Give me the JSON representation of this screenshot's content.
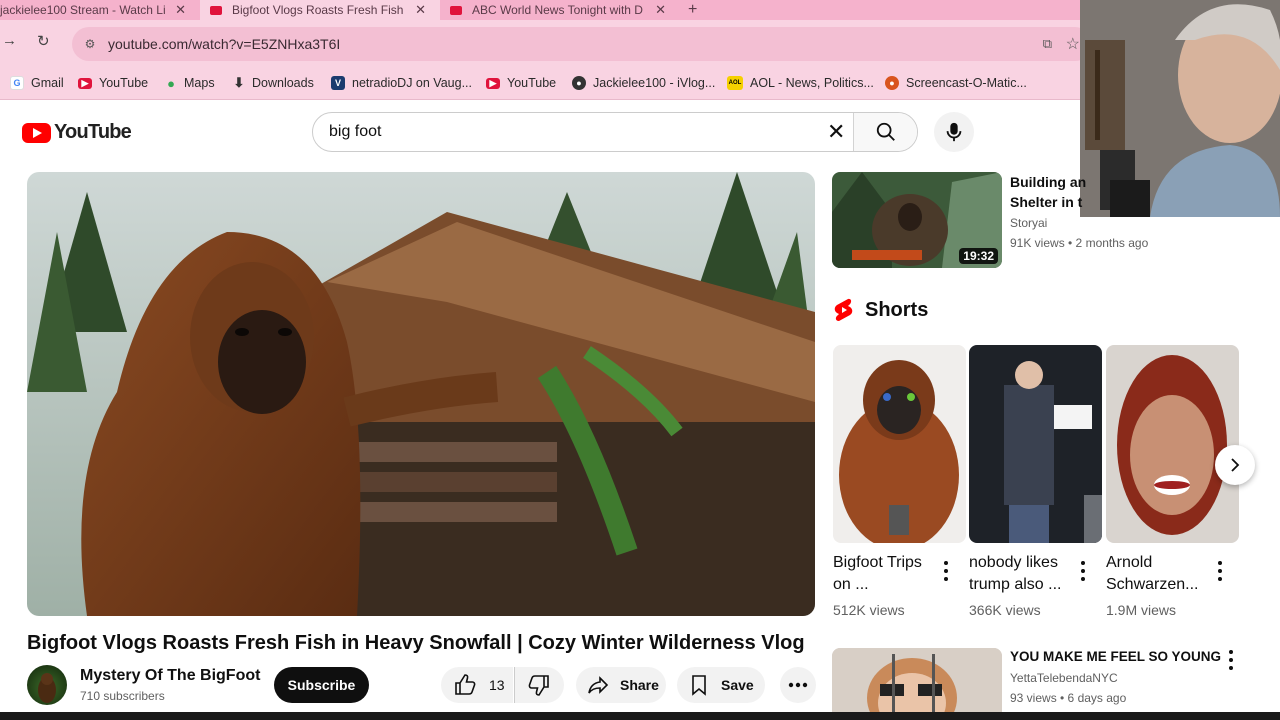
{
  "browser": {
    "tabs": [
      {
        "title": "jackielee100 Stream - Watch Li",
        "active": false
      },
      {
        "title": "Bigfoot Vlogs Roasts Fresh Fish",
        "active": true
      },
      {
        "title": "ABC World News Tonight with D",
        "active": false
      }
    ],
    "new_tab": "+",
    "url": "youtube.com/watch?v=E5ZNHxa3T6I",
    "bookmarks": [
      "Gmail",
      "YouTube",
      "Maps",
      "Downloads",
      "netradioDJ on Vaug...",
      "YouTube",
      "Jackielee100 - iVlog...",
      "AOL - News, Politics...",
      "Screencast-O-Matic..."
    ]
  },
  "header": {
    "logo": "YouTube",
    "search_value": "big foot"
  },
  "video": {
    "title": "Bigfoot Vlogs Roasts Fresh Fish in Heavy Snowfall | Cozy Winter Wilderness Vlog",
    "channel": "Mystery Of The BigFoot",
    "subscribers": "710 subscribers",
    "subscribe_label": "Subscribe",
    "likes": "13",
    "share_label": "Share",
    "save_label": "Save"
  },
  "related": [
    {
      "title_line1": "Building an",
      "title_line2": "Shelter in t",
      "channel": "Storyai",
      "meta": "91K views • 2 months ago",
      "duration": "19:32"
    },
    {
      "title": "YOU MAKE ME FEEL SO YOUNG",
      "channel": "YettaTelebendaNYC",
      "meta": "93 views • 6 days ago"
    }
  ],
  "shorts": {
    "heading": "Shorts",
    "items": [
      {
        "line1": "Bigfoot Trips",
        "line2": "on ...",
        "views": "512K views"
      },
      {
        "line1": "nobody likes",
        "line2": "trump also ...",
        "views": "366K views"
      },
      {
        "line1": "Arnold",
        "line2": "Schwarzen...",
        "views": "1.9M views"
      }
    ]
  },
  "colors": {
    "browser_frame": "#f9d3e2",
    "youtube_red": "#ff0000",
    "subscribe_bg": "#0f0f0f"
  },
  "icons": [
    "back-icon",
    "reload-icon",
    "tune-icon",
    "install-icon",
    "star-icon",
    "search-icon",
    "clear-icon",
    "mic-icon",
    "like-icon",
    "dislike-icon",
    "share-icon",
    "save-icon",
    "more-icon",
    "shorts-logo-icon",
    "chevron-right-icon"
  ]
}
